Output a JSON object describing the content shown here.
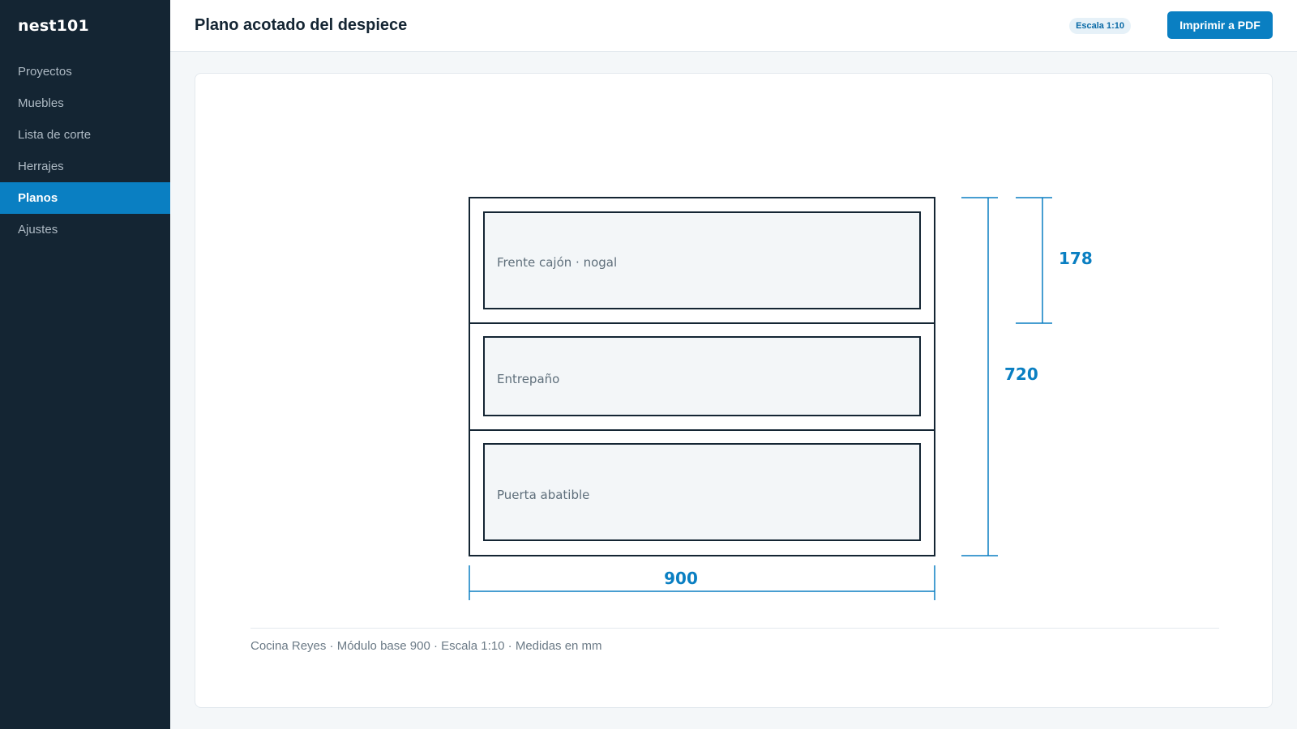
{
  "app": {
    "brand": "nest101"
  },
  "sidebar": {
    "items": [
      {
        "label": "Proyectos",
        "active": false
      },
      {
        "label": "Muebles",
        "active": false
      },
      {
        "label": "Lista de corte",
        "active": false
      },
      {
        "label": "Herrajes",
        "active": false
      },
      {
        "label": "Planos",
        "active": true
      },
      {
        "label": "Ajustes",
        "active": false
      }
    ]
  },
  "header": {
    "title": "Plano acotado del despiece",
    "scale_badge": "Escala 1:10",
    "print_label": "Imprimir a PDF"
  },
  "drawing": {
    "width_mm": 900,
    "height_mm": 720,
    "drawer_height_mm": 178,
    "panels": [
      {
        "label": "Frente cajón · nogal"
      },
      {
        "label": "Entrepaño"
      },
      {
        "label": "Puerta abatible"
      }
    ],
    "dimensions": {
      "width": "900",
      "height": "720",
      "drawer": "178"
    }
  },
  "footer": {
    "caption": "Cocina Reyes · Módulo base 900 · Escala 1:10 · Medidas en mm"
  },
  "colors": {
    "sidebar": "#142533",
    "accent": "#0a7fc2",
    "dimension": "#0a7fc2",
    "panel_fill": "#f3f6f8",
    "stroke": "#142533"
  }
}
